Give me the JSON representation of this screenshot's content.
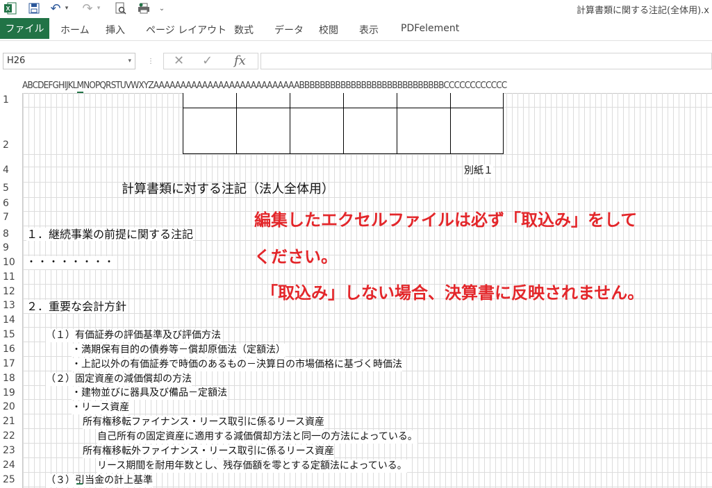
{
  "window": {
    "title": "計算書類に関する注記(全体用).x"
  },
  "quick_access": {
    "icons": [
      "excel-logo-icon",
      "save-icon",
      "undo-icon",
      "redo-icon",
      "print-preview-icon",
      "quick-print-icon",
      "customize-icon"
    ],
    "undo_glyph": "↶",
    "redo_glyph": "↷",
    "dropdown_glyph": "▾",
    "customize_glyph": "⌄"
  },
  "ribbon": {
    "file_tab": "ファイル",
    "tabs": [
      "ホーム",
      "挿入",
      "ページ レイアウト",
      "数式",
      "データ",
      "校閲",
      "表示",
      "PDFelement"
    ]
  },
  "formula_bar": {
    "name_box": "H26",
    "name_box_arrow": "▾",
    "cancel": "✕",
    "enter": "✓",
    "fx": "fx",
    "formula": ""
  },
  "columns": {
    "letters": "ABCDEFGHIJKLMNOPQRSTUVWXYZAAAAAAAAAAAAAAAAAAAAAAAAAAABBBBBBBBBBBBBBBBBBBBBBBBBBBBCCCCCCCCCCCC",
    "selected": "H"
  },
  "rows": [
    "1",
    "2",
    "4",
    "5",
    "6",
    "7",
    "8",
    "9",
    "10",
    "11",
    "12",
    "13",
    "14",
    "15",
    "16",
    "17",
    "18",
    "19",
    "20",
    "21",
    "22",
    "23",
    "24",
    "25"
  ],
  "sheet": {
    "attachment_label": "別紙１",
    "heading": "計算書類に対する注記（法人全体用）",
    "lines": [
      "１．継続事業の前提に関する注記",
      "・・・・・・・・",
      "２．重要な会計方針",
      "（１）有価証券の評価基準及び評価方法",
      "・満期保有目的の債券等－償却原価法（定額法）",
      "・上記以外の有価証券で時価のあるもの－決算日の市場価格に基づく時価法",
      "（２）固定資産の減価償却の方法",
      "・建物並びに器具及び備品－定額法",
      "・リース資産",
      "所有権移転ファイナンス・リース取引に係るリース資産",
      "自己所有の固定資産に適用する減価償却方法と同一の方法によっている。",
      "所有権移転外ファイナンス・リース取引に係るリース資産",
      "リース期間を耐用年数とし、残存価額を零とする定額法によっている。",
      "（３）引当金の計上基準"
    ],
    "notice": [
      "編集したエクセルファイルは必ず「取込み」をして",
      "ください。",
      "「取込み」しない場合、決算書に反映されません。"
    ]
  },
  "colors": {
    "excel_green": "#217346",
    "notice_red": "#e3262a"
  }
}
